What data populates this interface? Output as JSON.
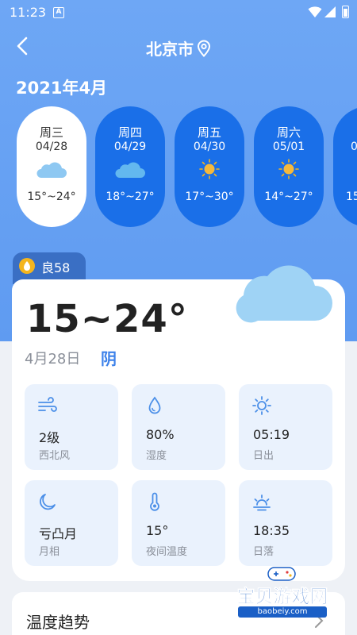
{
  "status_bar": {
    "time": "11:23",
    "notification_letter": "A"
  },
  "header": {
    "city": "北京市"
  },
  "month_label": "2021年4月",
  "days": [
    {
      "weekday": "周三",
      "date": "04/28",
      "icon": "cloud-icon",
      "temp": "15°~24°",
      "selected": true
    },
    {
      "weekday": "周四",
      "date": "04/29",
      "icon": "cloud-icon",
      "temp": "18°~27°",
      "selected": false
    },
    {
      "weekday": "周五",
      "date": "04/30",
      "icon": "sun-icon",
      "temp": "17°~30°",
      "selected": false
    },
    {
      "weekday": "周六",
      "date": "05/01",
      "icon": "sun-icon",
      "temp": "14°~27°",
      "selected": false
    },
    {
      "weekday": "",
      "date": "0",
      "icon": "",
      "temp": "15",
      "selected": false
    }
  ],
  "aqi": {
    "label": "良58"
  },
  "today": {
    "temp_range": "15~24°",
    "date": "4月28日",
    "condition": "阴"
  },
  "details": [
    {
      "icon": "wind-icon",
      "value": "2级",
      "label": "西北风"
    },
    {
      "icon": "humidity-icon",
      "value": "80%",
      "label": "湿度"
    },
    {
      "icon": "sunrise-icon",
      "value": "05:19",
      "label": "日出"
    },
    {
      "icon": "moon-icon",
      "value": "亏凸月",
      "label": "月相"
    },
    {
      "icon": "thermometer-icon",
      "value": "15°",
      "label": "夜间温度"
    },
    {
      "icon": "sunset-icon",
      "value": "18:35",
      "label": "日落"
    }
  ],
  "trend": {
    "title": "温度趋势"
  },
  "watermark": {
    "text": "宝贝游戏网",
    "url": "baobeiy.com"
  },
  "colors": {
    "background": "#6ea7f5",
    "pill": "#1a6fe8",
    "accent": "#3d82ea",
    "aqi_tab": "#3a6fc4",
    "sun": "#f4b51e",
    "tile": "#eaf2fd"
  }
}
